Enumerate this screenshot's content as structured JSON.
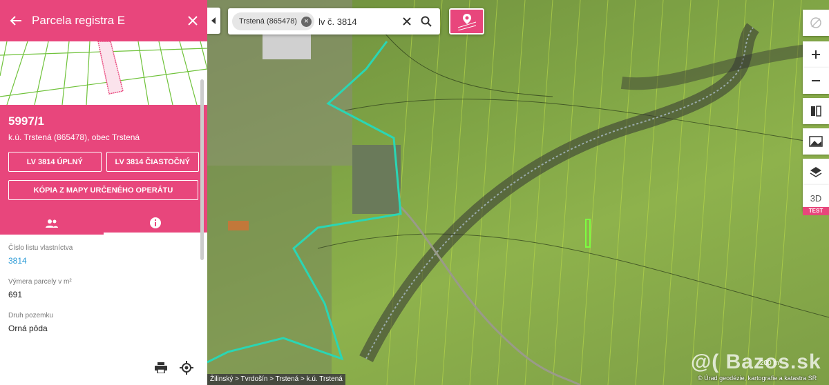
{
  "panel": {
    "title": "Parcela registra E",
    "parcel_number": "5997/1",
    "parcel_location": "k.ú. Trstená (865478), obec Trstená",
    "buttons": {
      "lv_full": "LV 3814 ÚPLNÝ",
      "lv_partial": "LV 3814 ČIASTOČNÝ",
      "copy_map": "KÓPIA Z MAPY URČENÉHO OPERÁTU"
    },
    "tabs": [
      {
        "icon": "people-icon",
        "active": false
      },
      {
        "icon": "info-icon",
        "active": true
      }
    ],
    "details": [
      {
        "label": "Číslo listu vlastníctva",
        "value": "3814",
        "link": true
      },
      {
        "label": "Výmera parcely v m²",
        "value": "691",
        "link": false
      },
      {
        "label": "Druh pozemku",
        "value": "Orná pôda",
        "link": false
      }
    ]
  },
  "search": {
    "chip": "Trstená (865478)",
    "query": "lv č. 3814"
  },
  "controls": {
    "mode_3d": "3D",
    "test_badge": "TEST"
  },
  "map": {
    "breadcrumb": "Žilinský > Tvrdošín > Trstená > k.ú. Trstená",
    "copyright": "© Úrad geodézie, kartografie a katastra SR",
    "scale": "200 m",
    "watermark": "@( Bazos.sk"
  },
  "colors": {
    "accent": "#e8467c",
    "link": "#2a9ad6",
    "boundary": "#2ad6b4"
  }
}
